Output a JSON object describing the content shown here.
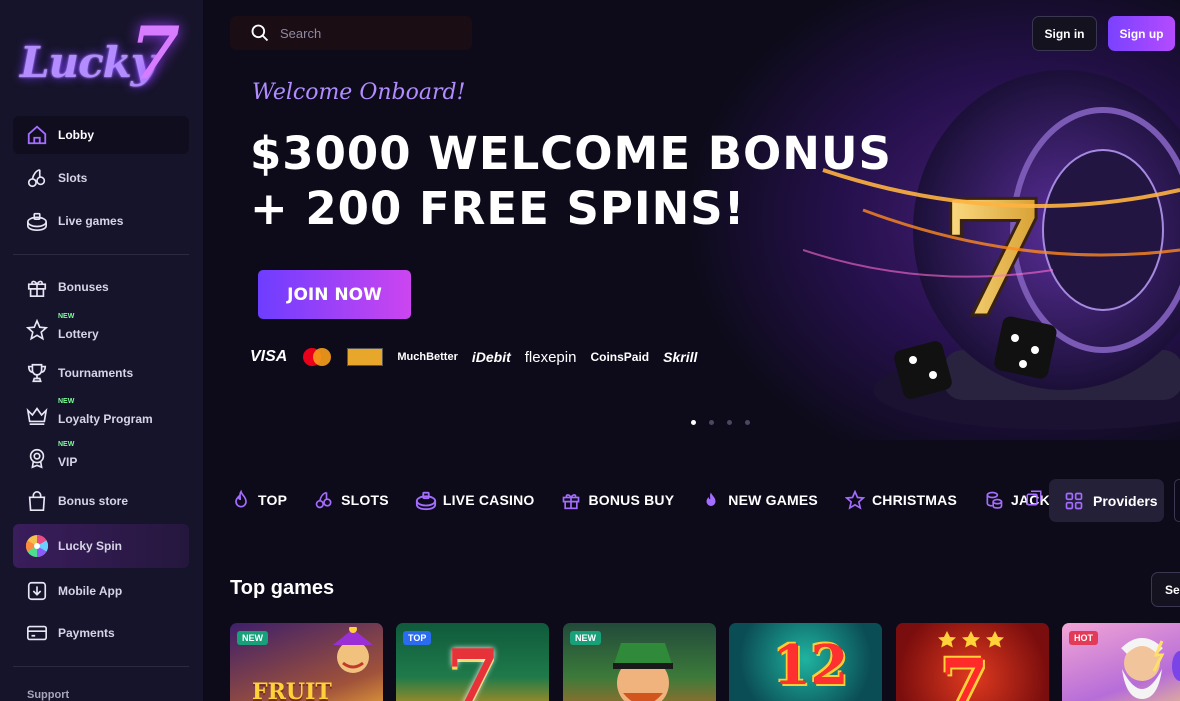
{
  "brand": {
    "logo_text": "Lucky",
    "logo_number": "7"
  },
  "sidebar": {
    "items": [
      {
        "label": "Lobby",
        "icon": "home-icon",
        "active": true
      },
      {
        "label": "Slots",
        "icon": "cherries-icon"
      },
      {
        "label": "Live games",
        "icon": "live-table-icon"
      },
      {
        "label": "Bonuses",
        "icon": "gift-icon"
      },
      {
        "label": "Lottery",
        "icon": "star-icon",
        "badge": "NEW"
      },
      {
        "label": "Tournaments",
        "icon": "trophy-icon"
      },
      {
        "label": "Loyalty Program",
        "icon": "crown-icon",
        "badge": "NEW"
      },
      {
        "label": "VIP",
        "icon": "vip-medal-icon",
        "badge": "NEW"
      },
      {
        "label": "Bonus store",
        "icon": "shopping-bag-icon"
      },
      {
        "label": "Lucky Spin",
        "icon": "wheel-icon"
      },
      {
        "label": "Mobile App",
        "icon": "download-icon"
      },
      {
        "label": "Payments",
        "icon": "card-icon"
      }
    ],
    "support_label": "Support"
  },
  "header": {
    "search_placeholder": "Search",
    "signin_label": "Sign in",
    "signup_label": "Sign up"
  },
  "hero": {
    "welcome": "Welcome Onboard!",
    "headline_line1": "$3000 WELCOME BONUS",
    "headline_line2": "+ 200 FREE SPINS!",
    "cta": "JOIN NOW",
    "payment_methods": [
      "VISA",
      "Mastercard",
      "Interac Online",
      "MuchBetter",
      "iDebit",
      "flexepin",
      "CoinsPaid",
      "Skrill"
    ],
    "slides": 4,
    "active_slide": 1
  },
  "categories": [
    {
      "label": "TOP",
      "icon": "flame-outline-icon"
    },
    {
      "label": "SLOTS",
      "icon": "cherries-icon"
    },
    {
      "label": "LIVE CASINO",
      "icon": "live-table-icon"
    },
    {
      "label": "BONUS BUY",
      "icon": "gift-icon"
    },
    {
      "label": "NEW GAMES",
      "icon": "fire-icon"
    },
    {
      "label": "CHRISTMAS",
      "icon": "star-icon"
    },
    {
      "label": "JACKPOT",
      "icon": "coins-icon"
    }
  ],
  "providers_label": "Providers",
  "top_games": {
    "title": "Top games",
    "see_all_label": "See",
    "games": [
      {
        "badge": "NEW",
        "art": "FRUIT"
      },
      {
        "badge": "TOP",
        "art": "7"
      },
      {
        "badge": "NEW",
        "art": ""
      },
      {
        "badge": "",
        "art": "12"
      },
      {
        "badge": "",
        "art": "7"
      },
      {
        "badge": "HOT",
        "art": ""
      }
    ]
  },
  "colors": {
    "accent": "#8c4bff",
    "background": "#0d0b1a",
    "sidebar": "#16142a",
    "new_badge": "#7dff9a"
  }
}
